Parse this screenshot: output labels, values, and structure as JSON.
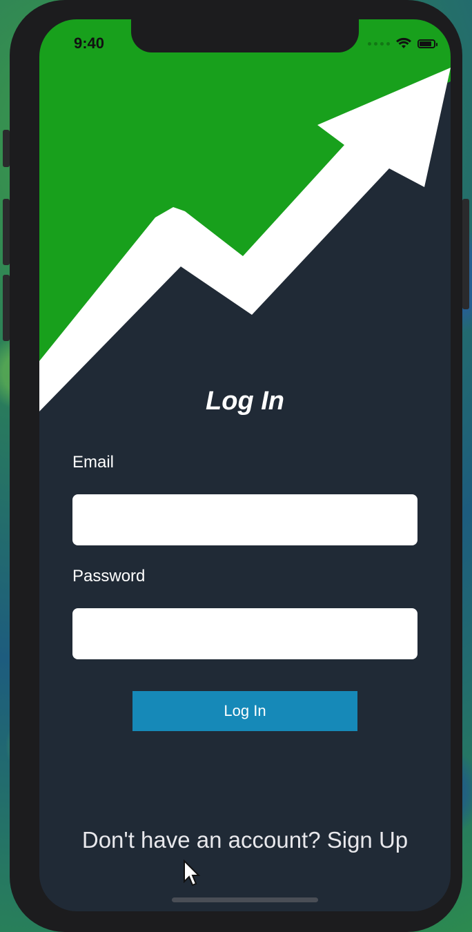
{
  "status_bar": {
    "time": "9:40",
    "icons": [
      "cellular-dots-icon",
      "wifi-icon",
      "battery-icon"
    ]
  },
  "hero": {
    "graphic": "trend-arrow-up-icon",
    "colors": {
      "green": "#18a01c",
      "arrow": "#ffffff",
      "dark": "#202a36"
    }
  },
  "login": {
    "title": "Log In",
    "email_label": "Email",
    "email_value": "",
    "password_label": "Password",
    "password_value": "",
    "submit_label": "Log In",
    "signup_text": "Don't have an account? Sign Up"
  },
  "colors": {
    "accent": "#1689b8",
    "background": "#202a36"
  }
}
